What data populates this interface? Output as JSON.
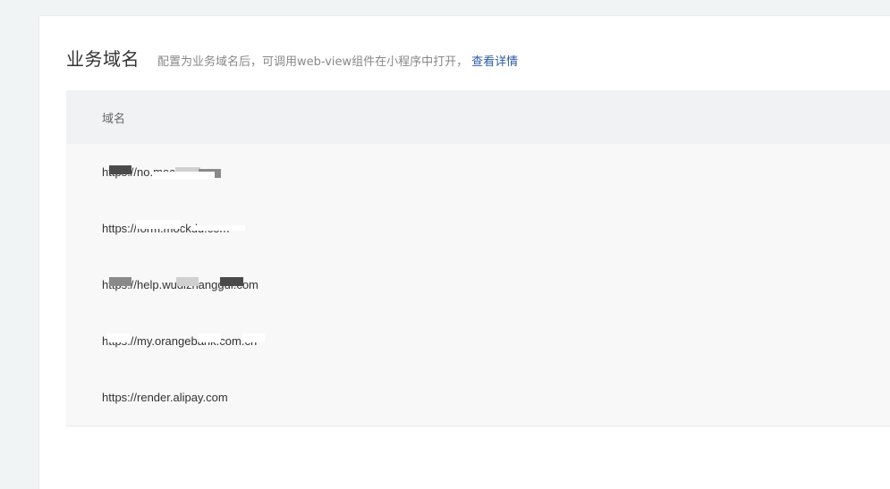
{
  "section": {
    "title": "业务域名",
    "description": "配置为业务域名后，可调用web-view组件在小程序中打开，",
    "detail_link": "查看详情"
  },
  "table": {
    "header": "域名",
    "rows": [
      {
        "domain": "https://no.mockdo.com"
      },
      {
        "domain": "https://form.mockdu.com"
      },
      {
        "domain": "https://help.wudizhanggui.com"
      },
      {
        "domain": "https://my.orangebank.com.cn"
      },
      {
        "domain": "https://render.alipay.com"
      }
    ]
  }
}
